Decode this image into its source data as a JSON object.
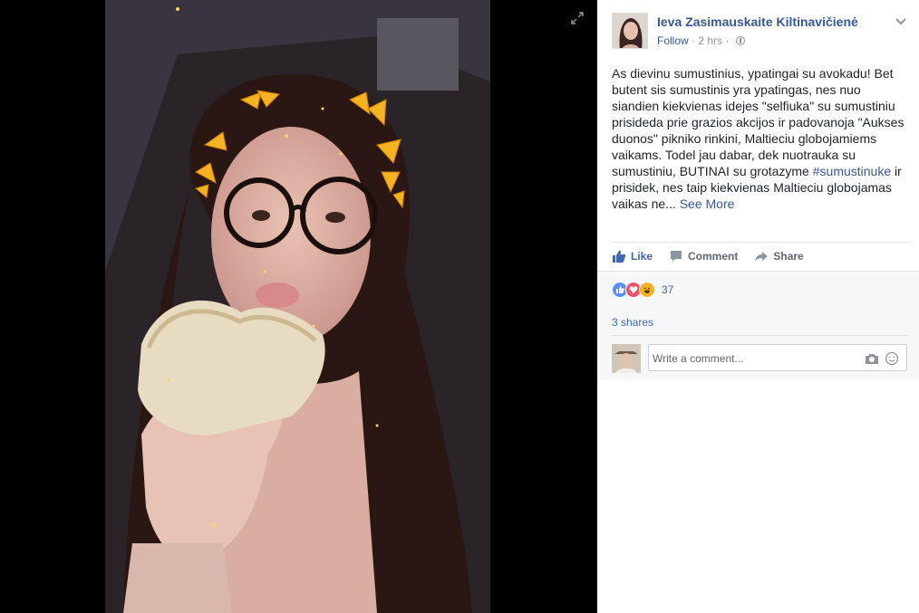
{
  "post": {
    "author": "Ieva Zasimauskaite Kiltinavičienė",
    "follow_label": "Follow",
    "time": "2 hrs",
    "text_main": "As dievinu sumustinius, ypatingai su avokadu! Bet butent sis sumustinis yra ypatingas, nes nuo siandien kiekvienas idejes \"selfiuka\" su sumustiniu prisideda prie grazios akcijos ir padovanoja \"Aukses duonos\" pikniko rinkini, Maltieciu globojamiems vaikams. Todel jau dabar, dek nuotrauka su sumustiniu, BUTINAI su grotazyme ",
    "hashtag": "#sumustinuke",
    "text_after": " ir prisidek, nes taip kiekvienas Maltieciu globojamas vaikas ne... ",
    "see_more": "See More"
  },
  "actions": {
    "like": "Like",
    "comment": "Comment",
    "share": "Share"
  },
  "feedback": {
    "reaction_count": "37",
    "shares": "3 shares",
    "comment_placeholder": "Write a comment..."
  },
  "icons": [
    "expand-icon",
    "globe-icon",
    "chevron-down-icon",
    "like-icon",
    "comment-icon",
    "share-icon",
    "camera-icon",
    "emoji-icon"
  ],
  "colors": {
    "link": "#365899",
    "accent": "#4267b2",
    "like_react": "#5890ff",
    "love_react": "#f25268",
    "haha_react": "#f7b125"
  }
}
